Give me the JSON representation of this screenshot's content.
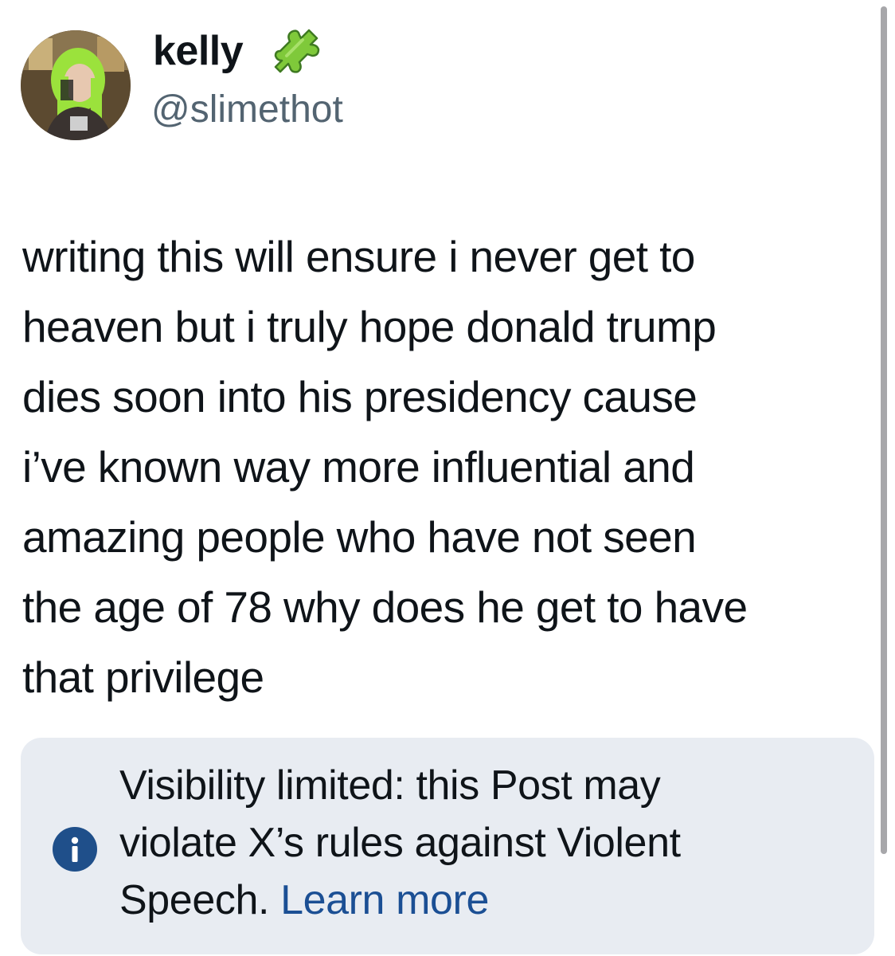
{
  "author": {
    "display_name": "kelly",
    "handle": "@slimethot",
    "badge_icon": "puzzle-piece-icon",
    "avatar_alt": "avatar"
  },
  "post": {
    "lines": [
      "writing this will ensure i never get to",
      "heaven but i truly hope donald trump",
      "dies soon into his presidency cause",
      "i’ve known way more influential and",
      "amazing people who have not seen",
      "the age of 78 why does he get to have",
      "that privilege"
    ]
  },
  "notice": {
    "icon": "info-icon",
    "lines": [
      "Visibility limited: this Post may",
      "violate X’s rules against Violent",
      "Speech."
    ],
    "link_label": "Learn more",
    "link_color": "#1b4f94",
    "background": "#e8ecf2"
  },
  "colors": {
    "text": "#0f1419",
    "muted": "#536471",
    "info_icon_bg": "#1f4f8a"
  }
}
